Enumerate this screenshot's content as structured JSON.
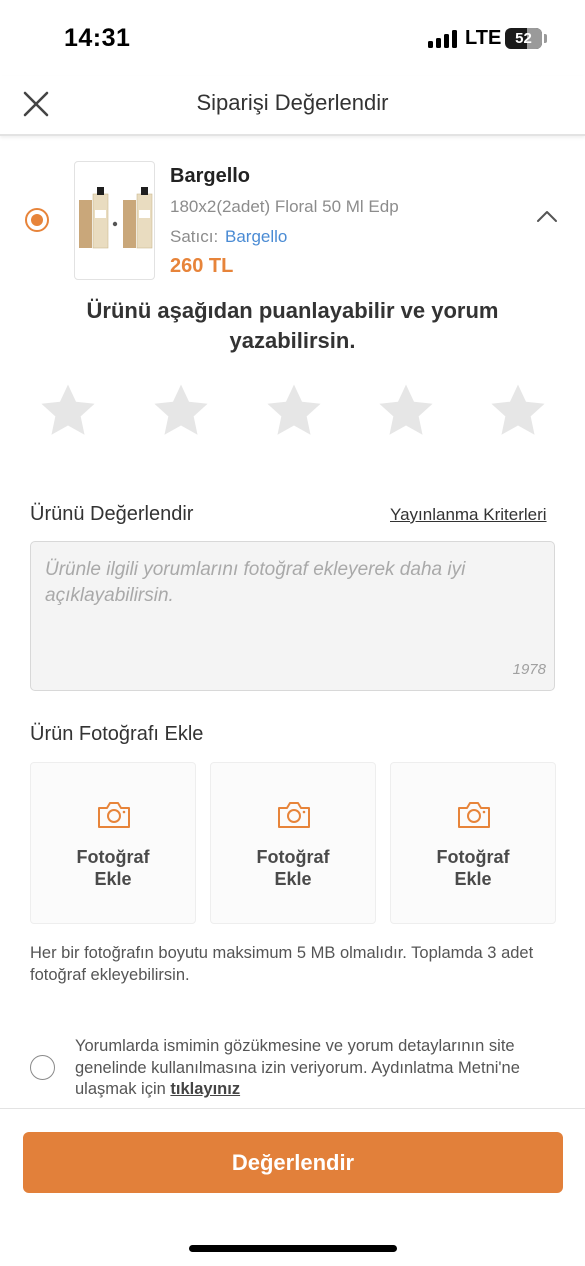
{
  "status_bar": {
    "time": "14:31",
    "network": "LTE",
    "battery": "52"
  },
  "nav": {
    "title": "Siparişi Değerlendir",
    "close_icon": "close-icon"
  },
  "product": {
    "name": "Bargello",
    "description": "180x2(2adet) Floral 50 Ml Edp",
    "seller_label": "Satıcı:",
    "seller_name": "Bargello",
    "price": "260 TL",
    "selected": true
  },
  "rating": {
    "prompt": "Ürünü aşağıdan puanlayabilir ve yorum yazabilirsin.",
    "max_stars": 5,
    "selected_stars": 0
  },
  "review": {
    "title": "Ürünü Değerlendir",
    "criteria_link": "Yayınlanma Kriterleri",
    "placeholder": "Ürünle ilgili yorumlarını fotoğraf ekleyerek daha iyi açıklayabilirsin.",
    "char_count": "1978"
  },
  "photos": {
    "title": "Ürün Fotoğrafı Ekle",
    "slot_label_line1": "Fotoğraf",
    "slot_label_line2": "Ekle",
    "info": "Her bir fotoğrafın boyutu maksimum 5 MB olmalıdır. Toplamda 3 adet fotoğraf ekleyebilirsin."
  },
  "consent": {
    "text": "Yorumlarda ismimin gözükmesine ve yorum detaylarının site genelinde kullanılmasına izin veriyorum. Aydınlatma Metni'ne ulaşmak için",
    "link": "tıklayınız"
  },
  "submit": {
    "label": "Değerlendir"
  },
  "colors": {
    "accent": "#e7843a",
    "link": "#4a8bd4",
    "star_inactive": "#e6e6e6"
  }
}
